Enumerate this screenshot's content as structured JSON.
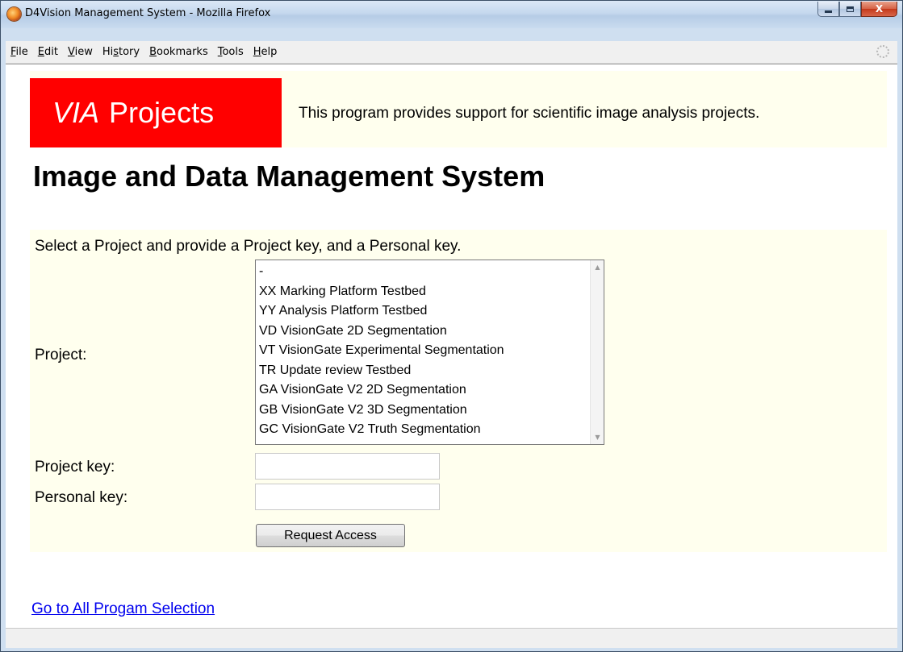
{
  "window": {
    "title": "D4Vision Management System - Mozilla Firefox",
    "min_glyph": "",
    "max_glyph": "",
    "close_glyph": "X"
  },
  "menubar": {
    "items": [
      {
        "label": "File",
        "accel": "F",
        "rest": "ile"
      },
      {
        "label": "Edit",
        "accel": "E",
        "rest": "dit"
      },
      {
        "label": "View",
        "accel": "V",
        "rest": "iew"
      },
      {
        "label": "History",
        "pre": "Hi",
        "accel": "s",
        "rest": "tory"
      },
      {
        "label": "Bookmarks",
        "accel": "B",
        "rest": "ookmarks"
      },
      {
        "label": "Tools",
        "accel": "T",
        "rest": "ools"
      },
      {
        "label": "Help",
        "accel": "H",
        "rest": "elp"
      }
    ]
  },
  "banner": {
    "logo_italic": "VIA",
    "logo_rest": "Projects",
    "tagline": "This program provides support for scientific image analysis projects.",
    "logo_color": "#ff0000",
    "background": "#ffffee"
  },
  "page": {
    "title": "Image and Data Management System"
  },
  "form": {
    "intro": "Select a Project and provide a Project key, and a Personal key.",
    "project_label": "Project:",
    "project_options": [
      "-",
      "XX Marking Platform Testbed",
      "YY Analysis Platform Testbed",
      "VD VisionGate 2D Segmentation",
      "VT VisionGate Experimental Segmentation",
      "TR Update review Testbed",
      "GA VisionGate V2 2D Segmentation",
      "GB VisionGate V2 3D Segmentation",
      "GC VisionGate V2 Truth Segmentation"
    ],
    "project_key_label": "Project key:",
    "project_key_value": "",
    "personal_key_label": "Personal key:",
    "personal_key_value": "",
    "submit_label": "Request Access"
  },
  "footer": {
    "link_label": "Go to All Progam Selection"
  }
}
